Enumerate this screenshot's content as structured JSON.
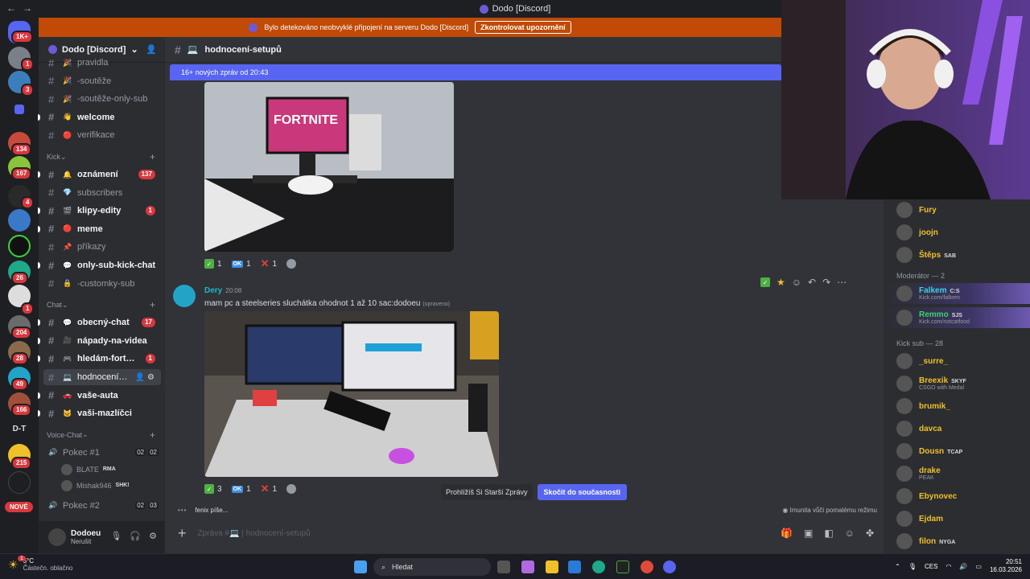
{
  "window": {
    "title": "Dodo [Discord]",
    "back": "←",
    "forward": "→"
  },
  "notice": {
    "text": "Bylo detekováno neobvyklé připojení na serveru Dodo [Discord]",
    "button": "Zkontrolovat upozornění"
  },
  "rail": {
    "badges": [
      "1K+",
      "1",
      "3",
      "134",
      "167",
      "4",
      "26",
      "1",
      "204",
      "28",
      "49",
      "166",
      "215"
    ],
    "text_item": "D-T",
    "new_label": "NOVÉ"
  },
  "server": {
    "name": "Dodo [Discord]"
  },
  "channels": [
    {
      "name": "pravidla",
      "emoji": "🎉",
      "state": "muted"
    },
    {
      "name": "-soutěže",
      "emoji": "🎉",
      "state": "muted"
    },
    {
      "name": "-soutěže-only-sub",
      "emoji": "🎉",
      "state": "muted"
    },
    {
      "name": "welcome",
      "emoji": "👋",
      "state": "unread"
    },
    {
      "name": "verifikace",
      "emoji": "🔴",
      "state": "muted"
    }
  ],
  "categories": {
    "kick": "Kick",
    "chat": "Chat",
    "voice": "Voice-Chat"
  },
  "kick_channels": [
    {
      "name": "oznámení",
      "emoji": "🔔",
      "state": "unread",
      "count": "137"
    },
    {
      "name": "subscribers",
      "emoji": "💎",
      "state": "muted"
    },
    {
      "name": "klipy-edity",
      "emoji": "🎬",
      "state": "unread",
      "count": "1"
    },
    {
      "name": "meme",
      "emoji": "🔴",
      "state": "unread"
    },
    {
      "name": "příkazy",
      "emoji": "📌",
      "state": "muted"
    },
    {
      "name": "only-sub-kick-chat",
      "emoji": "💬",
      "state": "unread"
    },
    {
      "name": "-customky-sub",
      "emoji": "🔒",
      "state": "muted"
    }
  ],
  "chat_channels": [
    {
      "name": "obecný-chat",
      "emoji": "💬",
      "state": "unread",
      "count": "17"
    },
    {
      "name": "nápady-na-videa",
      "emoji": "🎥",
      "state": "unread"
    },
    {
      "name": "hledám-fort…",
      "emoji": "🎮",
      "state": "unread",
      "count": "1"
    },
    {
      "name": "hodnocení…",
      "emoji": "💻",
      "state": "selected"
    },
    {
      "name": "vaše-auta",
      "emoji": "🚗",
      "state": "unread"
    },
    {
      "name": "vaši-mazlíčci",
      "emoji": "🐱",
      "state": "unread"
    }
  ],
  "voice": [
    {
      "name": "Pokec #1",
      "counts": [
        "02",
        "02"
      ],
      "users": [
        {
          "name": "BLATE",
          "tag": "RMA"
        },
        {
          "name": "Mishak946",
          "tag": "SHK!"
        }
      ]
    },
    {
      "name": "Pokec #2",
      "counts": [
        "02",
        "03"
      ]
    }
  ],
  "user": {
    "name": "Dodoeu",
    "status": "Nerušit"
  },
  "channel_header": {
    "name": "hodnocení-setupů"
  },
  "new_messages": "16+ nových zpráv od 20:43",
  "message1_reactions": [
    {
      "type": "check",
      "count": "1"
    },
    {
      "type": "ok",
      "label": "OK",
      "count": "1"
    },
    {
      "type": "x",
      "count": "1"
    }
  ],
  "message2": {
    "author": "Dery",
    "time": "20:08",
    "text": "mam pc a steelseries sluchátka ohodnot 1 až 10 sac:dodoeu",
    "edited": "(upraveno)"
  },
  "message2_reactions": [
    {
      "type": "check",
      "count": "3"
    },
    {
      "type": "ok",
      "label": "OK",
      "count": "1"
    },
    {
      "type": "x",
      "count": "1"
    }
  ],
  "image_text": {
    "fortnite": "FORTNITE"
  },
  "jump": {
    "older": "Prohlížíš Si Starší Zprávy",
    "jump": "Skočit do současnosti"
  },
  "typing": "fenix píše...",
  "slowmode": "Imunita vůči pomalému režimu",
  "composer": {
    "placeholder": "Zpráva #💻 | hodnocení-setupů"
  },
  "members": {
    "top": [
      {
        "name": "Fury",
        "color": "#f0c02a"
      },
      {
        "name": "joojn",
        "color": "#f0c02a"
      },
      {
        "name": "Štěps",
        "color": "#f0c02a",
        "tag": "SAB"
      }
    ],
    "moderator_header": "Moderátor — 2",
    "moderators": [
      {
        "name": "Falkem",
        "color": "#3cd3e6",
        "tag": "C:S",
        "sub": "Kick.com/falkem"
      },
      {
        "name": "Remmo",
        "color": "#3cd36a",
        "tag": "SJS",
        "sub": "Kick.com/notcatfood"
      }
    ],
    "kicksub_header": "Kick sub — 28",
    "kicksub": [
      {
        "name": "_surre_",
        "color": "#f0c02a"
      },
      {
        "name": "Breexik",
        "color": "#f0c02a",
        "tag": "SKYF",
        "sub": "CSGO with Medal"
      },
      {
        "name": "brumik_",
        "color": "#f0c02a"
      },
      {
        "name": "davca",
        "color": "#f0c02a"
      },
      {
        "name": "Dousn",
        "color": "#f0c02a",
        "tag": "TCAP"
      },
      {
        "name": "drake",
        "color": "#f0c02a",
        "sub": "PEAK"
      },
      {
        "name": "Ebynovec",
        "color": "#f0c02a"
      },
      {
        "name": "Ejdam",
        "color": "#f0c02a"
      },
      {
        "name": "filon",
        "color": "#f0c02a",
        "tag": "NYGA"
      }
    ]
  },
  "taskbar": {
    "temp": "5°C",
    "weather": "Částečn. oblačno",
    "search": "Hledat",
    "lang": "CES",
    "time": "20:51",
    "date": "16.03.2026",
    "badge": "1"
  }
}
